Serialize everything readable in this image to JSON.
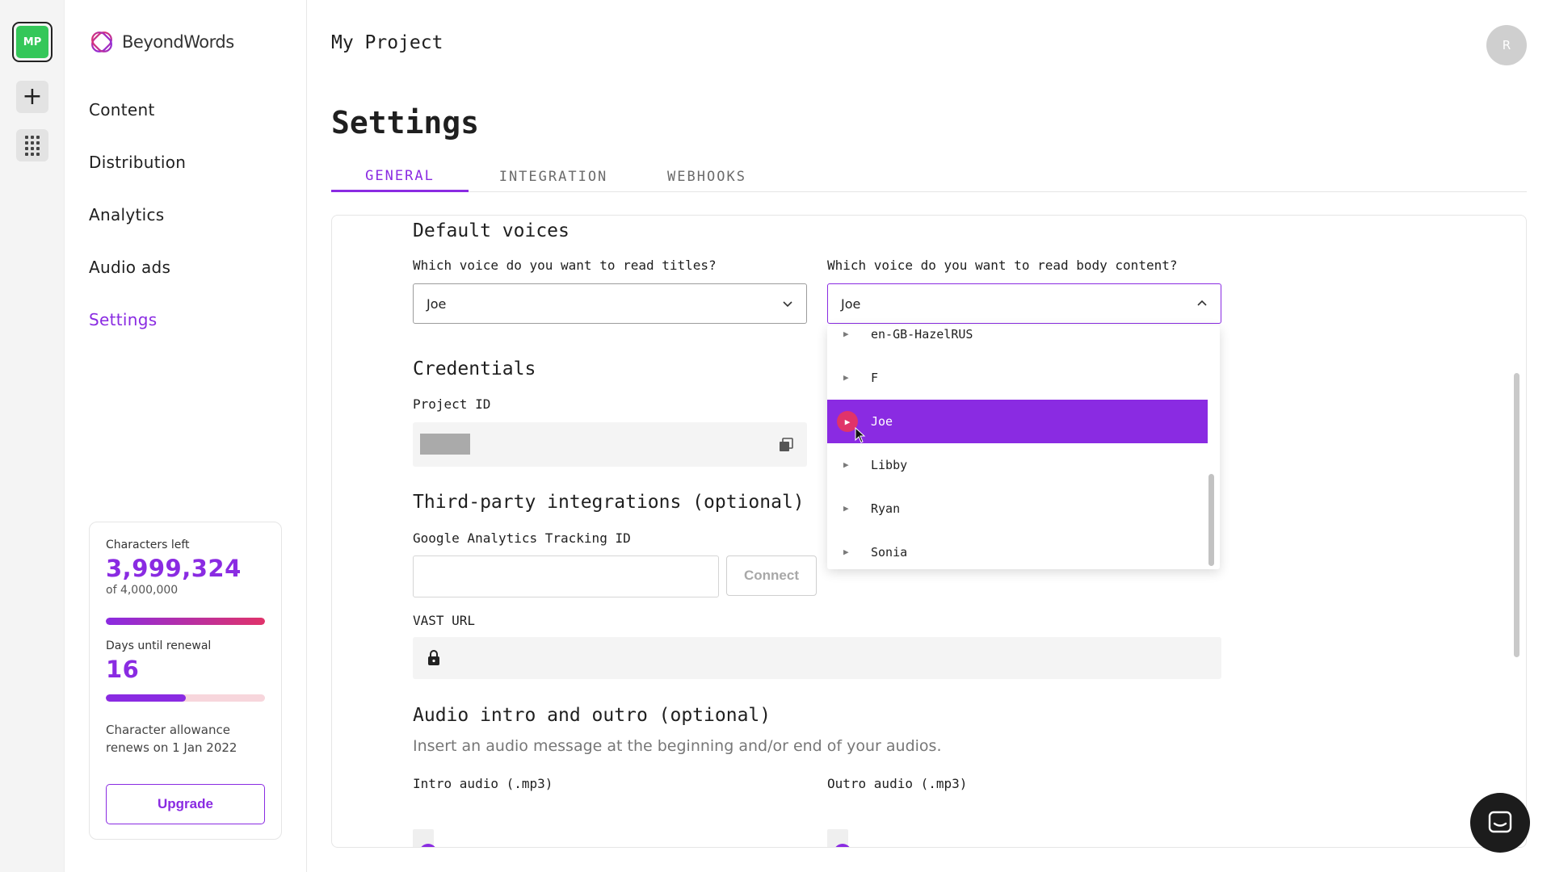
{
  "rail": {
    "workspace_initials": "MP",
    "add_icon": "plus-icon",
    "apps_icon": "grid-icon"
  },
  "brand": {
    "name": "BeyondWords",
    "accent": "#8a2be2",
    "accent_pink": "#e0336a"
  },
  "nav": {
    "items": [
      {
        "label": "Content"
      },
      {
        "label": "Distribution"
      },
      {
        "label": "Analytics"
      },
      {
        "label": "Audio ads"
      },
      {
        "label": "Settings",
        "active": true
      }
    ]
  },
  "usage": {
    "chars_label": "Characters left",
    "chars_value": "3,999,324",
    "chars_total": "of 4,000,000",
    "chars_fraction": 0.9998,
    "days_label": "Days until renewal",
    "days_value": "16",
    "days_fraction": 0.5,
    "renew_note": "Character allowance renews on 1 Jan 2022",
    "upgrade_label": "Upgrade"
  },
  "header": {
    "project_name": "My Project",
    "avatar_initial": "R"
  },
  "page": {
    "title": "Settings",
    "tabs": [
      {
        "label": "GENERAL",
        "active": true
      },
      {
        "label": "INTEGRATION"
      },
      {
        "label": "WEBHOOKS"
      }
    ]
  },
  "default_voices": {
    "heading": "Default voices",
    "titles_label": "Which voice do you want to read titles?",
    "titles_value": "Joe",
    "body_label": "Which voice do you want to read body content?",
    "body_value": "Joe",
    "options": [
      "en-GB-HazelRUS",
      "F",
      "Joe",
      "Libby",
      "Ryan",
      "Sonia"
    ],
    "selected_option": "Joe"
  },
  "credentials": {
    "heading": "Credentials",
    "project_id_label": "Project ID"
  },
  "integrations": {
    "heading": "Third-party integrations (optional)",
    "ga_label": "Google Analytics Tracking ID",
    "ga_value": "",
    "connect_label": "Connect",
    "vast_label": "VAST URL"
  },
  "audio": {
    "heading": "Audio intro and outro (optional)",
    "description": "Insert an audio message at the beginning and/or end of your audios.",
    "intro_label": "Intro audio (.mp3)",
    "outro_label": "Outro audio (.mp3)"
  }
}
